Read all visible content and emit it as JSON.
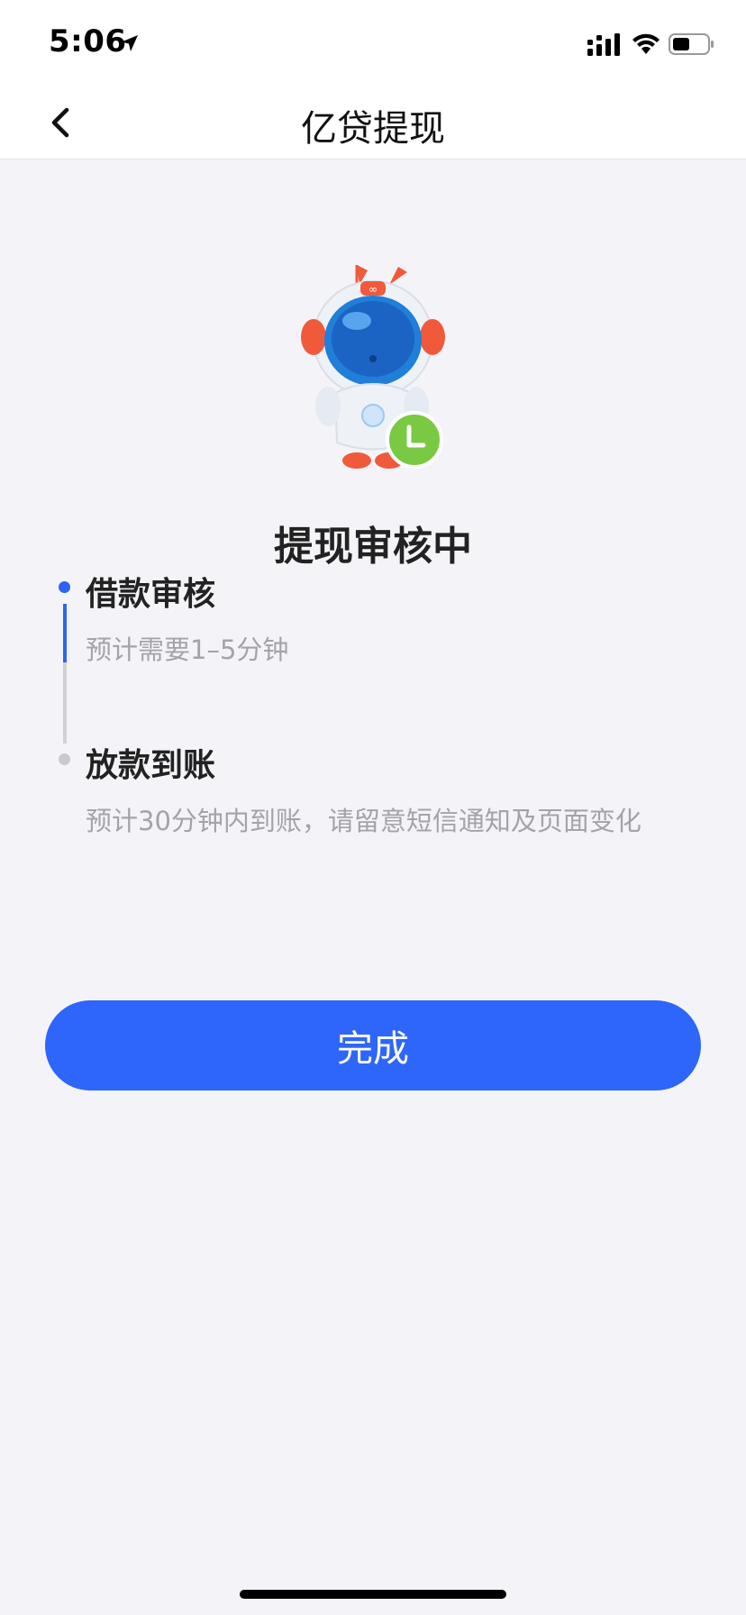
{
  "status_bar": {
    "time": "5:06"
  },
  "nav": {
    "title": "亿贷提现"
  },
  "status": {
    "title": "提现审核中"
  },
  "steps": [
    {
      "title": "借款审核",
      "desc": "预计需要1–5分钟"
    },
    {
      "title": "放款到账",
      "desc": "预计30分钟内到账，请留意短信通知及页面变化"
    }
  ],
  "done_label": "完成",
  "colors": {
    "accent": "#2e66fb",
    "background": "#f4f4f8",
    "clock_badge": "#7ac943"
  }
}
